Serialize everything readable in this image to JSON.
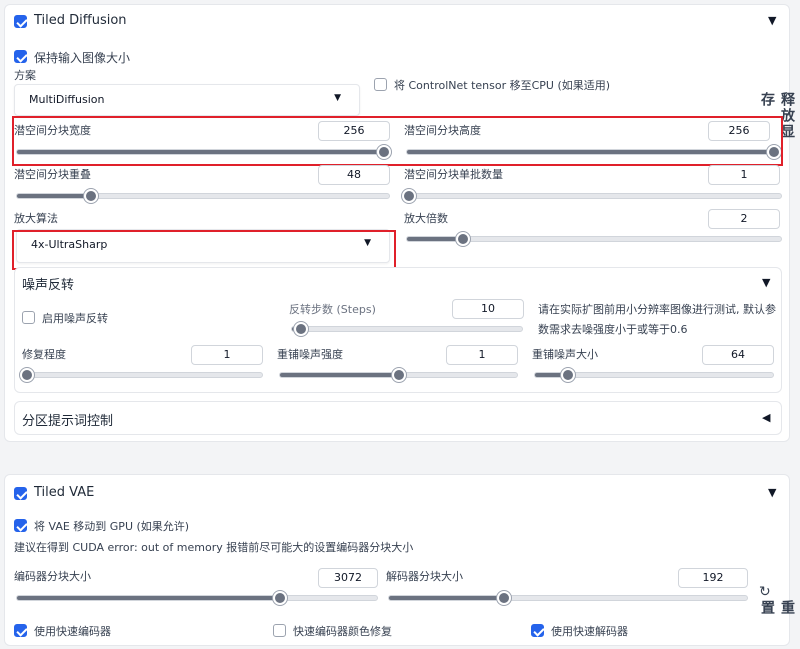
{
  "tiled_diffusion": {
    "title": "Tiled Diffusion",
    "enabled": true,
    "keep_size_label": "保持输入图像大小",
    "keep_size_checked": true,
    "method_label": "方案",
    "method_value": "MultiDiffusion",
    "controlnet_cpu_label": "将 ControlNet tensor 移至CPU (如果适用)",
    "controlnet_cpu_checked": false,
    "side_text": "释放显存",
    "tile_width": {
      "label": "潜空间分块宽度",
      "value": "256",
      "level": 1.0
    },
    "tile_height": {
      "label": "潜空间分块高度",
      "value": "256",
      "level": 1.0
    },
    "tile_overlap": {
      "label": "潜空间分块重叠",
      "value": "48",
      "level": 0.2
    },
    "tile_batch": {
      "label": "潜空间分块单批数量",
      "value": "1",
      "level": 0.0
    },
    "upscaler_label": "放大算法",
    "upscaler_value": "4x-UltraSharp",
    "scale": {
      "label": "放大倍数",
      "value": "2",
      "level": 0.15
    },
    "noise_inversion": {
      "title": "噪声反转",
      "enable_label": "启用噪声反转",
      "enable_checked": false,
      "steps": {
        "label": "反转步数 (Steps)",
        "value": "10",
        "level": 0.04
      },
      "note": "请在实际扩图前用小分辨率图像进行测试, 默认参数需求去噪强度小于或等于0.6",
      "fix": {
        "label": "修复程度",
        "value": "1",
        "level": 0.0
      },
      "renoise_strength": {
        "label": "重铺噪声强度",
        "value": "1",
        "level": 0.5
      },
      "renoise_size": {
        "label": "重铺噪声大小",
        "value": "64",
        "level": 0.14
      }
    },
    "region_prompt": {
      "title": "分区提示词控制"
    }
  },
  "tiled_vae": {
    "title": "Tiled VAE",
    "enabled": true,
    "move_vae_label": "将 VAE 移动到 GPU (如果允许)",
    "move_vae_checked": true,
    "advice": "建议在得到 CUDA error: out of memory 报错前尽可能大的设置编码器分块大小",
    "encoder_size": {
      "label": "编码器分块大小",
      "value": "3072",
      "level": 0.73
    },
    "decoder_size": {
      "label": "解码器分块大小",
      "value": "192",
      "level": 0.32
    },
    "side_text": "重置",
    "side_icon": "reset-icon",
    "fast_encoder": {
      "label": "使用快速编码器",
      "checked": true
    },
    "fast_encoder_color": {
      "label": "快速编码器颜色修复",
      "checked": false
    },
    "fast_decoder": {
      "label": "使用快速解码器",
      "checked": true
    }
  },
  "colors": {
    "accent": "#2563eb",
    "highlight": "#e0202a"
  }
}
